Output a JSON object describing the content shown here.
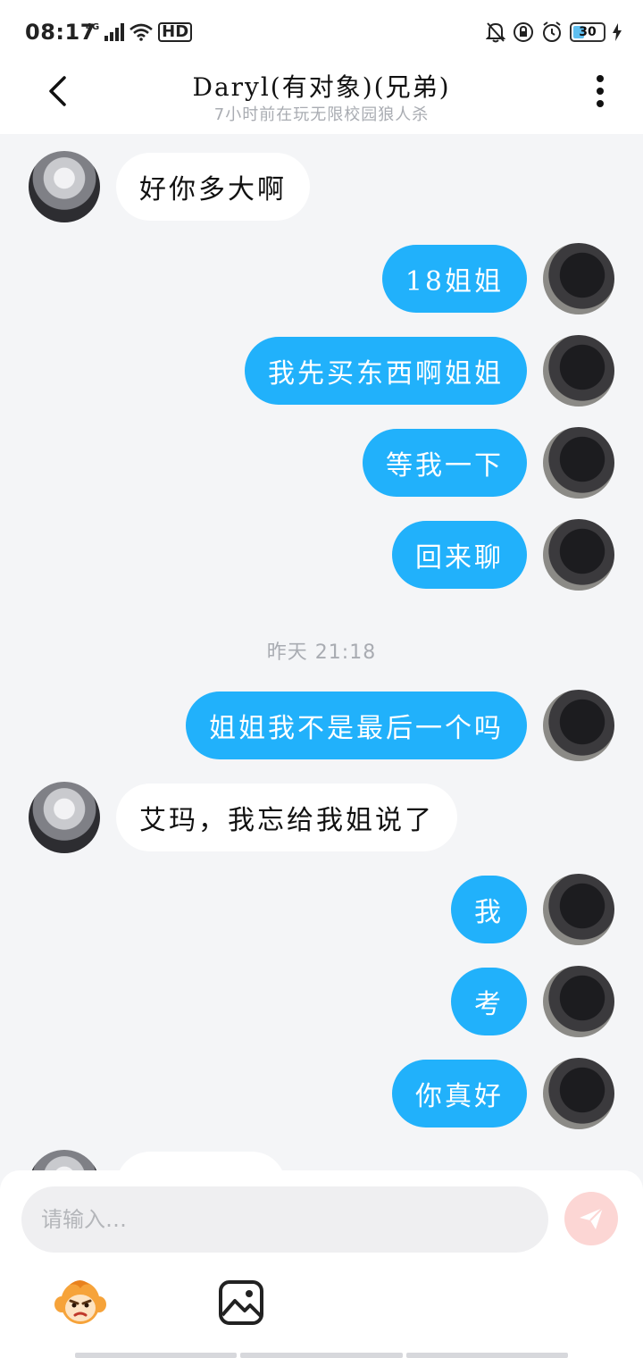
{
  "status_bar": {
    "time": "08:17",
    "network": "4G",
    "hd": "HD",
    "battery": "30"
  },
  "header": {
    "title": "Daryl(有对象)(兄弟)",
    "subtitle": "7小时前在玩无限校园狼人杀"
  },
  "chat": {
    "messages_a": [
      {
        "side": "left",
        "text": "好你多大啊"
      },
      {
        "side": "right",
        "text": "18姐姐"
      },
      {
        "side": "right",
        "text": "我先买东西啊姐姐"
      },
      {
        "side": "right",
        "text": "等我一下"
      },
      {
        "side": "right",
        "text": "回来聊"
      }
    ],
    "timestamp": "昨天 21:18",
    "messages_b": [
      {
        "side": "right",
        "text": "姐姐我不是最后一个吗"
      },
      {
        "side": "left",
        "text": "艾玛，我忘给我姐说了"
      },
      {
        "side": "right",
        "text": "我"
      },
      {
        "side": "right",
        "text": "考"
      },
      {
        "side": "right",
        "text": "你真好"
      }
    ]
  },
  "input": {
    "placeholder": "请输入…"
  },
  "icons": {
    "back": "chevron-left-icon",
    "more": "more-vertical-icon",
    "send": "send-icon",
    "emoji": "monkey-emoji-icon",
    "image": "image-icon"
  },
  "colors": {
    "bubble_me": "#21b1fb",
    "bubble_friend": "#ffffff",
    "background": "#f4f5f7",
    "send_disabled": "#fcd6d4"
  }
}
